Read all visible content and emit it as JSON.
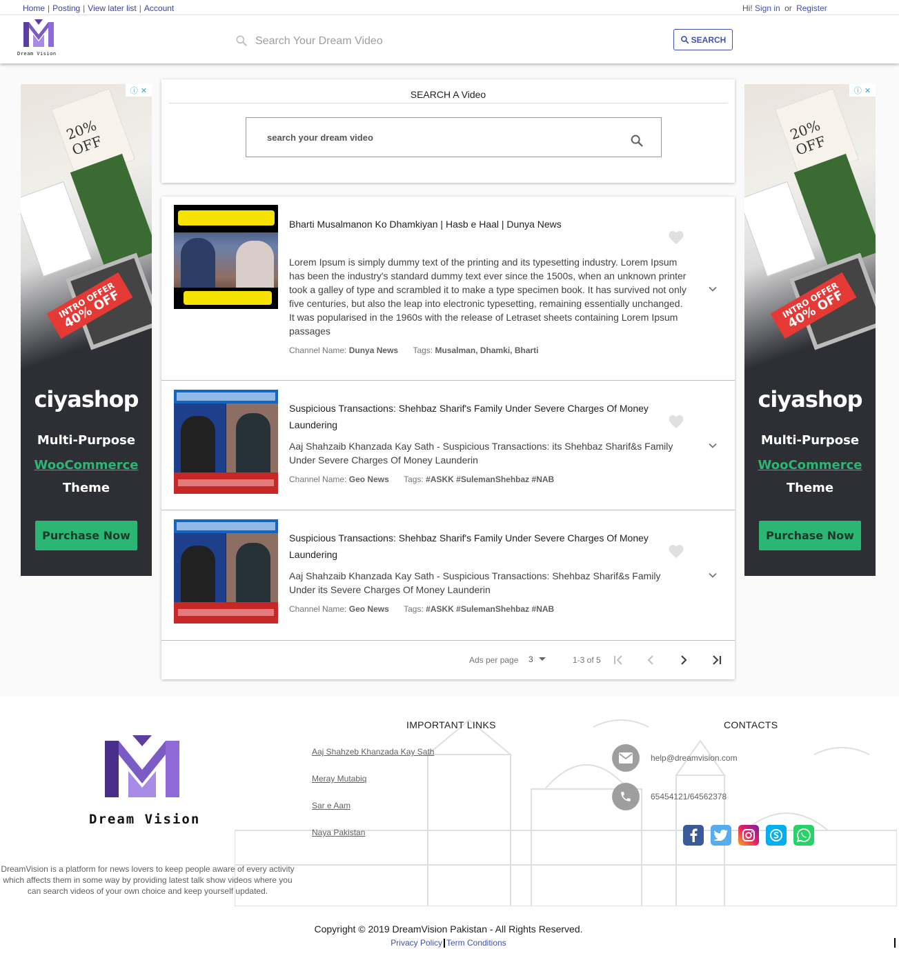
{
  "nav": {
    "links": [
      "Home",
      "Posting",
      "View later list",
      "Account"
    ],
    "greeting": "Hi!",
    "sign_in": "Sign in",
    "or": "or",
    "register": "Register"
  },
  "brand": {
    "name": "Dream Vision"
  },
  "header_search": {
    "placeholder": "Search Your Dream Video",
    "button": "SEARCH"
  },
  "search_card": {
    "title": "SEARCH A Video",
    "placeholder": "search your dream video"
  },
  "ads": {
    "offer_line1": "INTRO OFFER",
    "offer_line2": "40% OFF",
    "collage_text": "20% OFF",
    "brand": "ciyashop",
    "line1": "Multi-Purpose",
    "line2": "WooCommerce",
    "line3": "Theme",
    "cta": "Purchase Now"
  },
  "results": [
    {
      "title": "Bharti Musalmanon Ko Dhamkiyan | Hasb e Haal | Dunya News",
      "description": "Lorem Ipsum is simply dummy text of the printing and its typesetting industry. Lorem Ipsum has been the industry's standard dummy text ever since the 1500s, when an unknown printer took a galley of type and scrambled it to make a type specimen book. It has survived not only five centuries, but also the leap into electronic typesetting, remaining essentially unchanged. It was popularised in the 1960s with the release of Letraset sheets containing Lorem Ipsum passages",
      "channel_label": "Channel Name:",
      "channel": "Dunya News",
      "tags_label": "Tags:",
      "tags": "Musalman, Dhamki, Bharti"
    },
    {
      "title": "Suspicious Transactions: Shehbaz Sharif's Family Under Severe Charges Of Money Laundering",
      "description": "Aaj Shahzaib Khanzada Kay Sath - Suspicious Transactions: its Shehbaz Sharif&s Family Under Severe Charges Of Money Launderin",
      "channel_label": "Channel Name:",
      "channel": "Geo News",
      "tags_label": "Tags:",
      "tags": "#ASKK #SulemanShehbaz #NAB"
    },
    {
      "title": "Suspicious Transactions: Shehbaz Sharif's Family Under Severe Charges Of Money Laundering",
      "description": "Aaj Shahzaib Khanzada Kay Sath - Suspicious Transactions: Shehbaz Sharif&s Family Under its Severe Charges Of Money Launderin",
      "channel_label": "Channel Name:",
      "channel": "Geo News",
      "tags_label": "Tags:",
      "tags": "#ASKK #SulemanShehbaz #NAB"
    }
  ],
  "paginator": {
    "label": "Ads per page",
    "per_page": "3",
    "range": "1-3 of 5"
  },
  "footer": {
    "about": "DreamVision is a platform for news lovers to keep people aware of every activity which affects them in some way by providing latest talk show videos where you can search videos of your own choice and keep yourself updated.",
    "links_heading": "IMPORTANT LINKS",
    "links": [
      "Aaj Shahzeb Khanzada Kay Sath",
      "Meray Mutabiq",
      "Sar e Aam",
      "Naya Pakistan"
    ],
    "contacts_heading": "CONTACTS",
    "email": "help@dreamvision.com",
    "phone": "65454121/64562378",
    "social": [
      "facebook-icon",
      "twitter-icon",
      "instagram-icon",
      "skype-icon",
      "whatsapp-icon"
    ],
    "copyright": "Copyright © 2019 DreamVision Pakistan - All Rights Reserved.",
    "privacy": "Privacy Policy",
    "terms": "Term Conditions"
  },
  "colors": {
    "accent": "#3f51b5",
    "logo_purple": "#7b5cc4",
    "ad_green": "#2bb673",
    "ad_red": "#e53935"
  }
}
